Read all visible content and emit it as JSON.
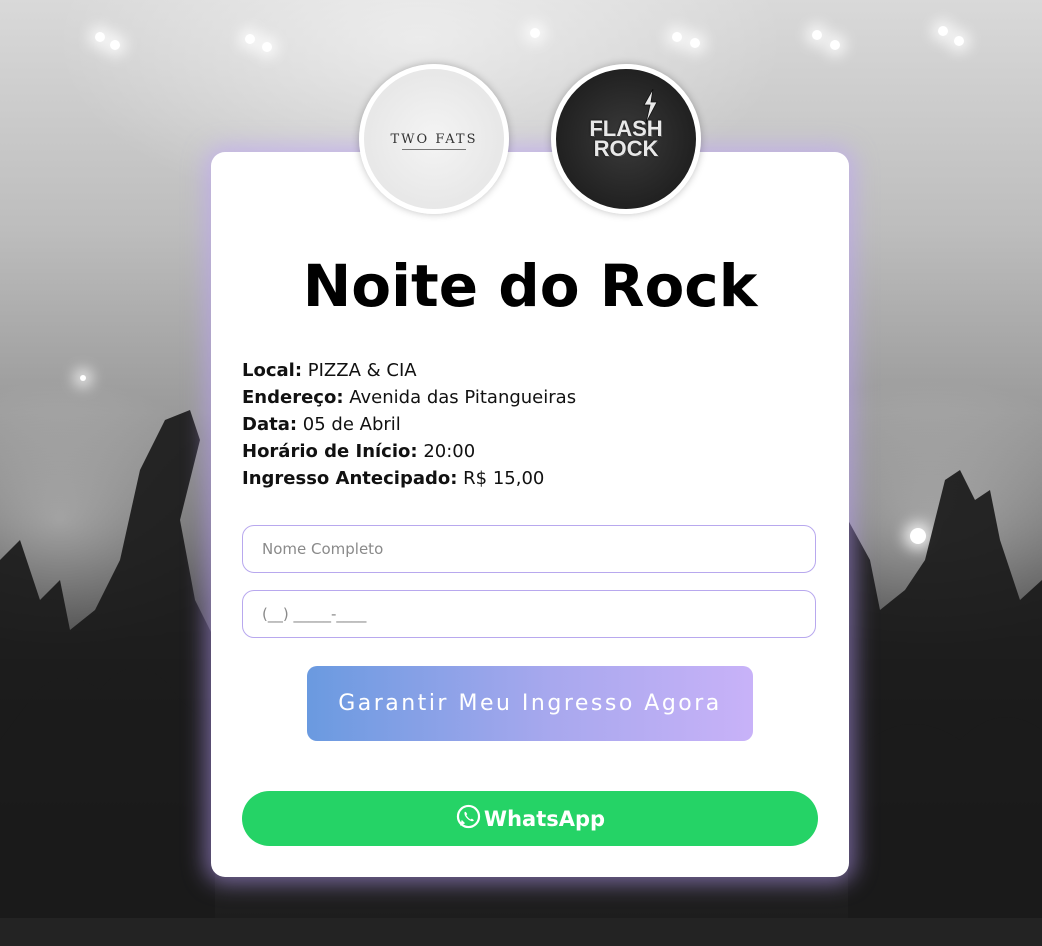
{
  "logos": {
    "left_text": "TWO FATS",
    "right_line1": "FLASH",
    "right_line2": "ROCK"
  },
  "event": {
    "title": "Noite do Rock",
    "details": [
      {
        "label": "Local:",
        "value": "PIZZA & CIA"
      },
      {
        "label": "Endereço:",
        "value": "Avenida das Pitangueiras"
      },
      {
        "label": "Data:",
        "value": "05 de Abril"
      },
      {
        "label": "Horário de Início:",
        "value": "20:00"
      },
      {
        "label": "Ingresso Antecipado:",
        "value": "R$ 15,00"
      }
    ]
  },
  "form": {
    "name_placeholder": "Nome Completo",
    "phone_placeholder": "(__) _____-____",
    "submit_label": "Garantir Meu Ingresso Agora"
  },
  "whatsapp": {
    "label": "WhatsApp",
    "icon": "whatsapp-icon",
    "color": "#25d366"
  },
  "colors": {
    "card_glow": "#bea0ff",
    "cta_start": "#6a9ae0",
    "cta_end": "#c8b2f8",
    "input_border": "#b8a8ee"
  }
}
